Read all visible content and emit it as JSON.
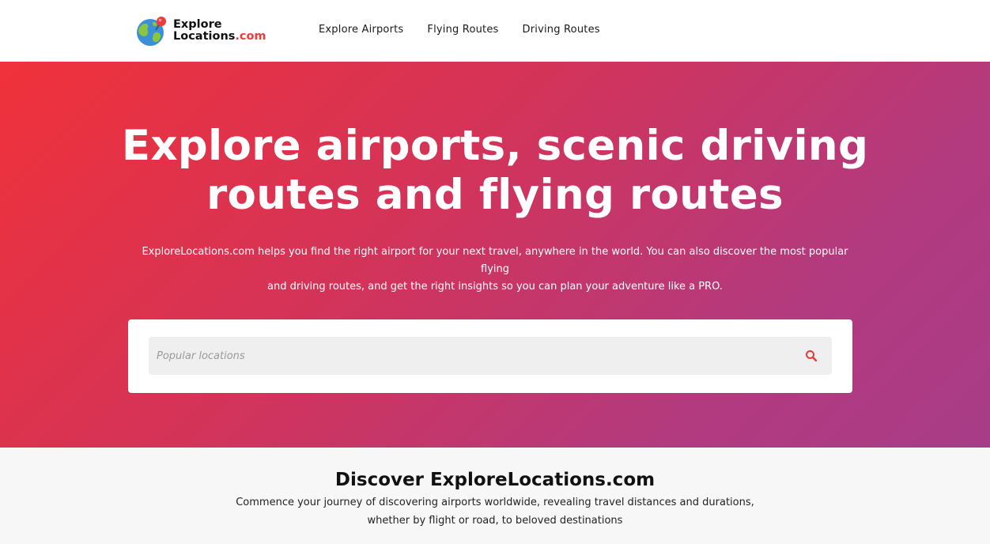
{
  "header": {
    "logo": {
      "line1": "Explore",
      "line2_main": "Locations",
      "line2_suffix": ".com"
    },
    "nav": [
      {
        "label": "Explore Airports"
      },
      {
        "label": "Flying Routes"
      },
      {
        "label": "Driving Routes"
      }
    ]
  },
  "hero": {
    "title_line1": "Explore airports, scenic driving",
    "title_line2": "routes and flying routes",
    "description_line1": "ExploreLocations.com helps you find the right airport for your next travel, anywhere in the world. You can also discover the most popular flying",
    "description_line2": "and driving routes, and get the right insights so you can plan your adventure like a PRO.",
    "search": {
      "placeholder": "Popular locations",
      "value": "",
      "icon": "search-icon"
    }
  },
  "discover": {
    "title": "Discover ExploreLocations.com",
    "text_line1": "Commence your journey of discovering airports worldwide, revealing travel distances and durations,",
    "text_line2": "whether by flight or road, to beloved destinations"
  },
  "colors": {
    "accent": "#ef3b3b",
    "gradient_start": "#f0323a",
    "gradient_end": "#a83c88",
    "search_icon": "#e63a3a"
  }
}
